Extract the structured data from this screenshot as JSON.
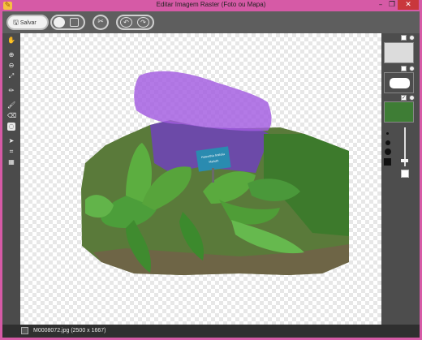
{
  "window": {
    "title": "Editar Imagem Raster (Foto ou Mapa)"
  },
  "titlebar": {
    "minimize": "–",
    "maximize": "❐",
    "close": "✕"
  },
  "toolbar": {
    "save_label": "Salvar"
  },
  "image": {
    "sign_line1": "Haworthia limifolia",
    "sign_line2": "Marloth"
  },
  "status": {
    "filename": "M0008072.jpg (2500 x 1667)"
  },
  "colors": {
    "window_border": "#d65aa6",
    "selection": "#a25be0"
  }
}
